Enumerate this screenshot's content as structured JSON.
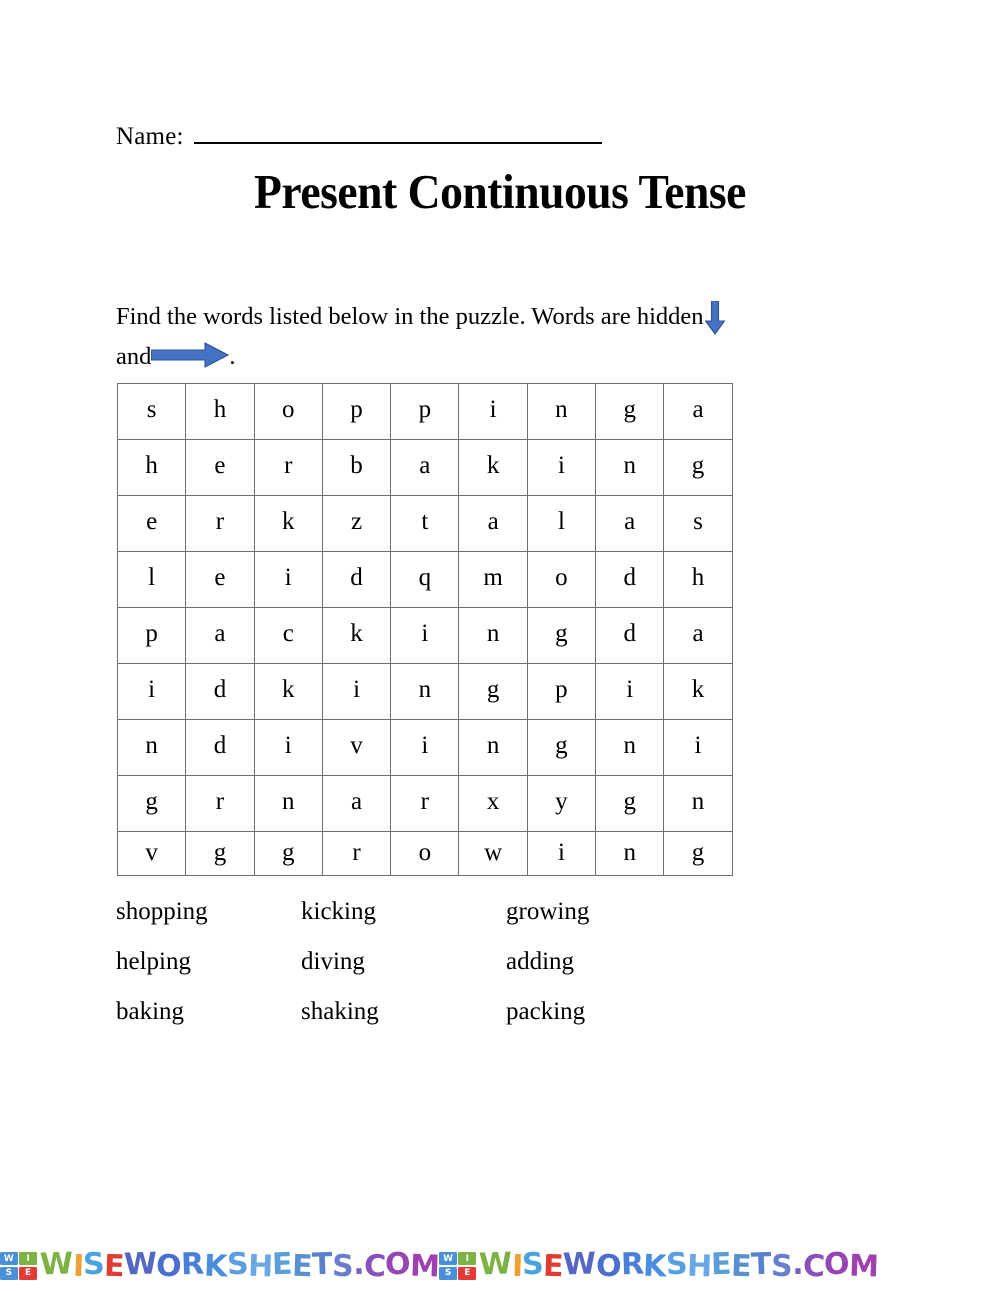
{
  "header": {
    "name_label": "Name:",
    "title": "Present Continuous Tense"
  },
  "instructions": {
    "part1": "Find the words listed below in the puzzle. Words are hidden",
    "part2": "and",
    "part3": ".",
    "down_arrow_icon": "arrow-down-icon",
    "right_arrow_icon": "arrow-right-icon",
    "arrow_fill_color": "#4472c4",
    "arrow_stroke_color": "#2f528f"
  },
  "puzzle": {
    "rows": 9,
    "cols": 9,
    "border_color": "#6e6e6e",
    "grid": [
      [
        "s",
        "h",
        "o",
        "p",
        "p",
        "i",
        "n",
        "g",
        "a"
      ],
      [
        "h",
        "e",
        "r",
        "b",
        "a",
        "k",
        "i",
        "n",
        "g"
      ],
      [
        "e",
        "r",
        "k",
        "z",
        "t",
        "a",
        "l",
        "a",
        "s"
      ],
      [
        "l",
        "e",
        "i",
        "d",
        "q",
        "m",
        "o",
        "d",
        "h"
      ],
      [
        "p",
        "a",
        "c",
        "k",
        "i",
        "n",
        "g",
        "d",
        "a"
      ],
      [
        "i",
        "d",
        "k",
        "i",
        "n",
        "g",
        "p",
        "i",
        "k"
      ],
      [
        "n",
        "d",
        "i",
        "v",
        "i",
        "n",
        "g",
        "n",
        "i"
      ],
      [
        "g",
        "r",
        "n",
        "a",
        "r",
        "x",
        "y",
        "g",
        "n"
      ],
      [
        "v",
        "g",
        "g",
        "r",
        "o",
        "w",
        "i",
        "n",
        "g"
      ]
    ]
  },
  "wordlist": {
    "rows": [
      [
        "shopping",
        "kicking",
        "growing"
      ],
      [
        "helping",
        "diving",
        "adding"
      ],
      [
        "baking",
        "shaking",
        "packing"
      ]
    ]
  },
  "footer": {
    "logo_letters": [
      {
        "char": "W",
        "color": "#4a90d9"
      },
      {
        "char": "I",
        "color": "#7cb342"
      },
      {
        "char": "S",
        "color": "#4a90d9"
      },
      {
        "char": "E",
        "color": "#e53935"
      }
    ],
    "text_letters": [
      {
        "char": "W",
        "color": "#7cb342"
      },
      {
        "char": "I",
        "color": "#f0a030"
      },
      {
        "char": "S",
        "color": "#4aa3df"
      },
      {
        "char": "E",
        "color": "#e03c31"
      },
      {
        "char": "W",
        "color": "#5566c4"
      },
      {
        "char": "O",
        "color": "#4a6fd0"
      },
      {
        "char": "R",
        "color": "#4a7fd8"
      },
      {
        "char": "K",
        "color": "#4a8fdd"
      },
      {
        "char": "S",
        "color": "#5a9fe0"
      },
      {
        "char": "H",
        "color": "#6aa8e4"
      },
      {
        "char": "E",
        "color": "#5b9fd8"
      },
      {
        "char": "E",
        "color": "#5a8fd0"
      },
      {
        "char": "T",
        "color": "#5a82cc"
      },
      {
        "char": "S",
        "color": "#6a7fcc"
      },
      {
        "char": ".",
        "color": "#7a5fc0"
      },
      {
        "char": "C",
        "color": "#8a4fbb"
      },
      {
        "char": "O",
        "color": "#9645b5"
      },
      {
        "char": "M",
        "color": "#a03fb0"
      }
    ],
    "repeat": 2
  }
}
